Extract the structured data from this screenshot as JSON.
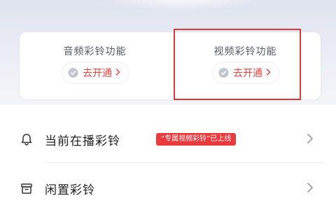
{
  "features": [
    {
      "title": "音频彩铃功能",
      "button_label": "去开通",
      "icon": "check-circle-icon"
    },
    {
      "title": "视频彩铃功能",
      "button_label": "去开通",
      "icon": "check-circle-icon"
    }
  ],
  "rows": [
    {
      "label": "当前在播彩铃",
      "icon": "bell-icon",
      "badge": "“专属视频彩铃”已上线"
    },
    {
      "label": "闲置彩铃",
      "icon": "archive-box-icon"
    }
  ],
  "colors": {
    "accent_red": "#e0473d",
    "badge_red": "#e93a3e",
    "highlight_border": "#d63a3a",
    "muted_icon": "#c3c6cc"
  }
}
